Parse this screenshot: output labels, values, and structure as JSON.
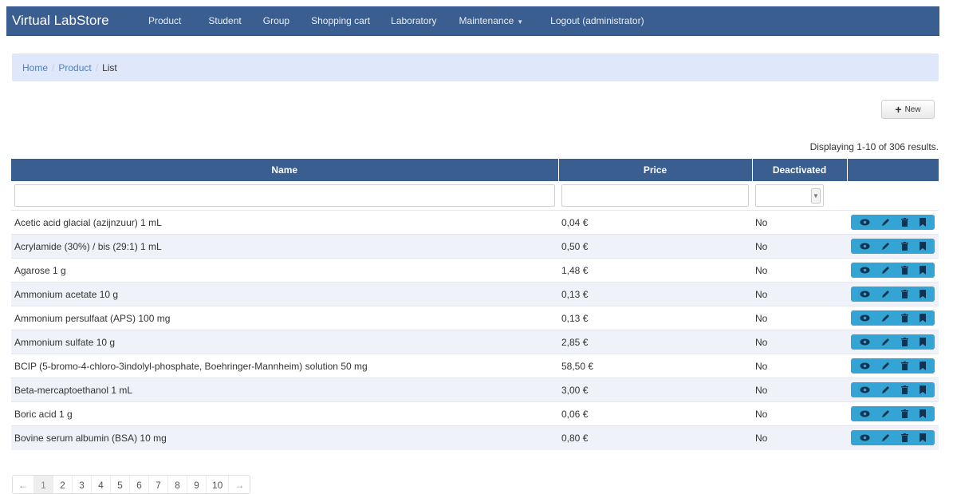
{
  "navbar": {
    "brand": "Virtual LabStore",
    "items": [
      "Product",
      "Student",
      "Group",
      "Shopping cart",
      "Laboratory",
      "Maintenance",
      "Logout (administrator)"
    ]
  },
  "breadcrumb": {
    "home": "Home",
    "product": "Product",
    "current": "List"
  },
  "toolbar": {
    "new_label": "New"
  },
  "summary": "Displaying 1-10 of 306 results.",
  "table": {
    "headers": {
      "name": "Name",
      "price": "Price",
      "deactivated": "Deactivated"
    },
    "rows": [
      {
        "name": "Acetic acid glacial (azijnzuur) 1 mL",
        "price": "0,04 €",
        "deactivated": "No"
      },
      {
        "name": "Acrylamide (30%) / bis (29:1) 1 mL",
        "price": "0,50 €",
        "deactivated": "No"
      },
      {
        "name": "Agarose 1 g",
        "price": "1,48 €",
        "deactivated": "No"
      },
      {
        "name": "Ammonium acetate 10 g",
        "price": "0,13 €",
        "deactivated": "No"
      },
      {
        "name": "Ammonium persulfaat (APS) 100 mg",
        "price": "0,13 €",
        "deactivated": "No"
      },
      {
        "name": "Ammonium sulfate 10 g",
        "price": "2,85 €",
        "deactivated": "No"
      },
      {
        "name": "BCIP (5-bromo-4-chloro-3indolyl-phosphate, Boehringer-Mannheim) solution 50 mg",
        "price": "58,50 €",
        "deactivated": "No"
      },
      {
        "name": "Beta-mercaptoethanol 1 mL",
        "price": "3,00 €",
        "deactivated": "No"
      },
      {
        "name": "Boric acid 1 g",
        "price": "0,06 €",
        "deactivated": "No"
      },
      {
        "name": "Bovine serum albumin (BSA) 10 mg",
        "price": "0,80 €",
        "deactivated": "No"
      }
    ]
  },
  "pager": {
    "prev": "←",
    "pages": [
      "1",
      "2",
      "3",
      "4",
      "5",
      "6",
      "7",
      "8",
      "9",
      "10"
    ],
    "next": "→",
    "active": "1"
  },
  "icons": {
    "view": "eye-icon",
    "edit": "pencil-icon",
    "delete": "trash-icon",
    "bookmark": "bookmark-icon"
  },
  "colors": {
    "navbar": "#3b5e91",
    "breadcrumb_bg": "#dfe8fb",
    "link": "#4f7ec0",
    "action_button": "#34a4d4",
    "row_alt": "#f0f2f9"
  }
}
